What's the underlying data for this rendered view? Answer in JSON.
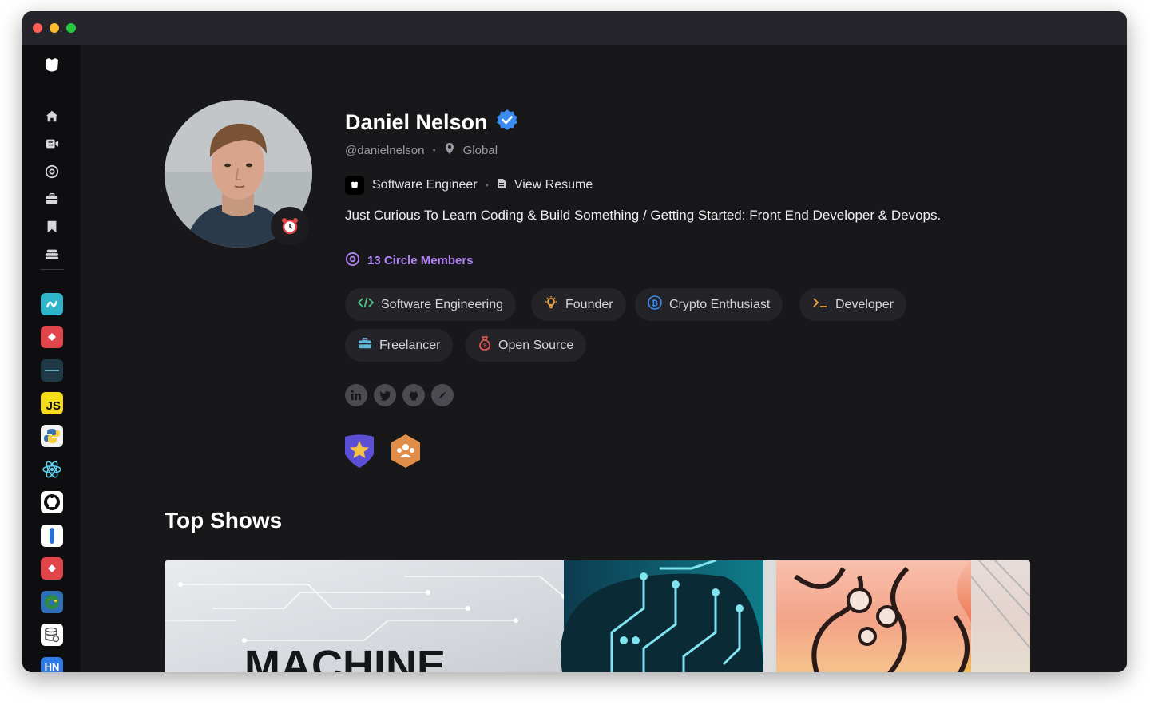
{
  "window": {
    "title": ""
  },
  "profile": {
    "name": "Daniel Nelson",
    "handle": "@danielnelson",
    "location": "Global",
    "role": "Software Engineer",
    "resume_label": "View Resume",
    "bio": "Just Curious To Learn Coding & Build Something / Getting Started: Front End Developer & Devops.",
    "circle_members": "13 Circle Members",
    "verified": true
  },
  "tags": [
    {
      "label": "Software Engineering",
      "icon": "code-icon"
    },
    {
      "label": "Founder",
      "icon": "lightbulb-icon"
    },
    {
      "label": "Crypto Enthusiast",
      "icon": "bitcoin-icon"
    },
    {
      "label": "Developer",
      "icon": "terminal-icon"
    },
    {
      "label": "Freelancer",
      "icon": "briefcase-icon"
    },
    {
      "label": "Open Source",
      "icon": "money-bag-icon"
    }
  ],
  "socials": [
    "linkedin-icon",
    "twitter-icon",
    "github-icon",
    "compass-icon"
  ],
  "section": {
    "top_shows": "Top Shows"
  },
  "banner": {
    "text": "MACHINE"
  },
  "sidebar_apps": [
    "JS",
    "HN"
  ],
  "colors": {
    "accent_purple": "#b183f5",
    "verified_blue": "#3b8cf0",
    "background": "#18181a",
    "sidebar": "#0e0e10"
  }
}
